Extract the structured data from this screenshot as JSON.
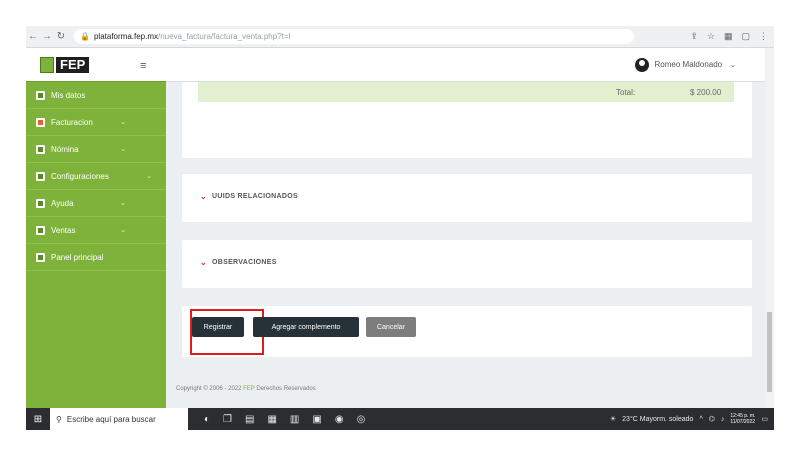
{
  "browser": {
    "url_domain": "plataforma.fep.mx",
    "url_path": "/nueva_factura/factura_venta.php?t=I"
  },
  "sidebar": {
    "logo_text": "FEP",
    "items": [
      {
        "label": "Mis datos",
        "icon": "id-card-icon",
        "caret": ""
      },
      {
        "label": "Facturacion",
        "icon": "document-icon",
        "caret": "⌄"
      },
      {
        "label": "Nómina",
        "icon": "payroll-icon",
        "caret": "⌄"
      },
      {
        "label": "Configuraciones",
        "icon": "settings-icon",
        "caret": "⌄"
      },
      {
        "label": "Ayuda",
        "icon": "help-icon",
        "caret": "⌄"
      },
      {
        "label": "Ventas",
        "icon": "sales-icon",
        "caret": "⌄"
      },
      {
        "label": "Panel principal",
        "icon": "dashboard-icon",
        "caret": ""
      }
    ]
  },
  "topbar": {
    "user_name": "Romeo Maldonado"
  },
  "totals": {
    "label": "Total:",
    "value": "$ 200.00"
  },
  "sections": {
    "uuids_title": "UUIDS RELACIONADOS",
    "observaciones_title": "OBSERVACIONES"
  },
  "actions": {
    "registrar": "Registrar",
    "agregar": "Agregar complemento",
    "cancelar": "Cancelar"
  },
  "footer": {
    "prefix": "Copyright © 2006 - 2022",
    "brand": "FEP",
    "suffix": "Derechos Reservados"
  },
  "taskbar": {
    "search_placeholder": "Escribe aquí para buscar",
    "weather": "23°C  Mayorm. soleado",
    "time": "12:45 p. m.",
    "date": "11/07/2022"
  },
  "colors": {
    "sidebar_green": "#7fb23a",
    "highlight_red": "#e11b1b",
    "button_dark": "#263238"
  }
}
